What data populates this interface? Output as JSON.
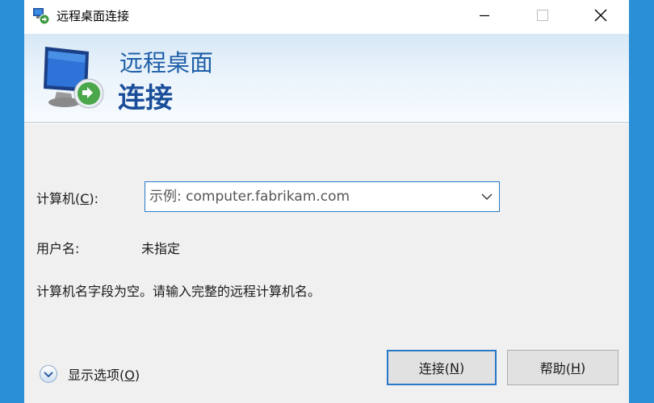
{
  "window": {
    "title": "远程桌面连接",
    "controls": {
      "minimize": "minimize-icon",
      "maximize": "maximize-icon",
      "close": "close-icon"
    }
  },
  "banner": {
    "line1": "远程桌面",
    "line2": "连接"
  },
  "form": {
    "computer": {
      "label_prefix": "计算机(",
      "label_key": "C",
      "label_suffix": "):",
      "value": "",
      "placeholder": "示例: computer.fabrikam.com"
    },
    "user": {
      "label": "用户名:",
      "value": "未指定"
    },
    "message": "计算机名字段为空。请输入完整的远程计算机名。"
  },
  "footer": {
    "show_options": {
      "prefix": "显示选项(",
      "key": "O",
      "suffix": ")"
    },
    "connect": {
      "prefix": "连接(",
      "key": "N",
      "suffix": ")"
    },
    "help": {
      "prefix": "帮助(",
      "key": "H",
      "suffix": ")"
    }
  },
  "colors": {
    "accent": "#2a78c8",
    "banner_title": "#1f5fa8",
    "desktop": "#2b8fd6"
  }
}
